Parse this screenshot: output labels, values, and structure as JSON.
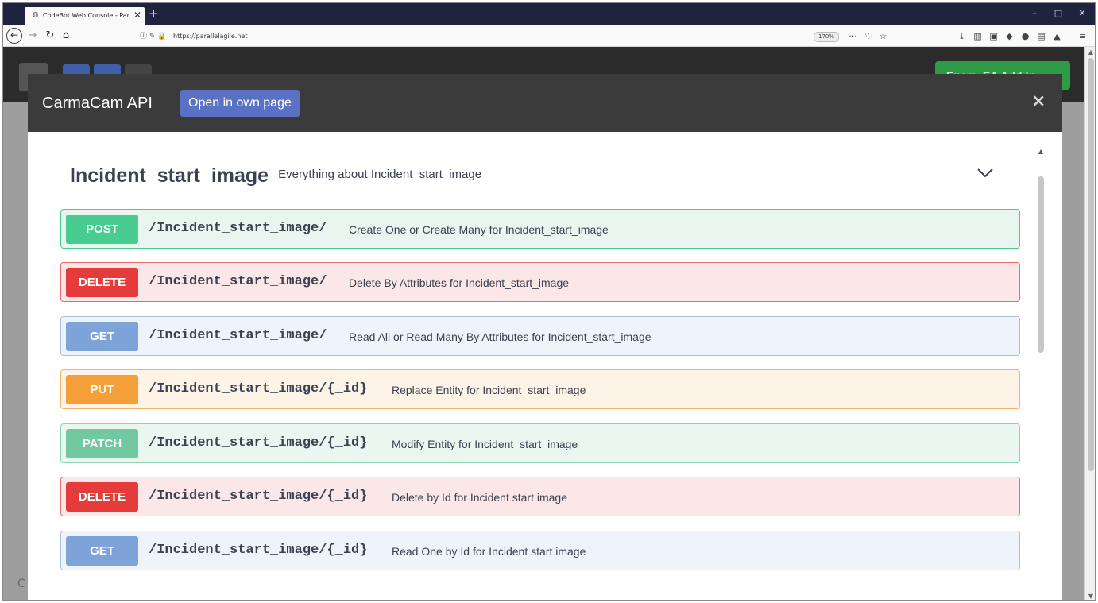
{
  "browser": {
    "tab_title": "CodeBot Web Console - Paral",
    "new_tab": "+",
    "tab_close": "✕",
    "url": "https://parallelagile.net",
    "zoom": "170%",
    "window_controls": {
      "minimize": "–",
      "maximize": "□",
      "close": "✕"
    },
    "nav_icons": [
      "back-icon",
      "forward-icon",
      "reload-icon",
      "home-icon"
    ],
    "url_icons": [
      "info-icon",
      "permissions-icon",
      "lock-icon"
    ],
    "toolbar_icons": [
      "more-icon",
      "pocket-icon",
      "bookmark-star-icon",
      "download-icon",
      "library-icon",
      "reader-icon",
      "shield-icon",
      "addon-icon",
      "extension-icon",
      "extension2-icon",
      "menu-icon"
    ]
  },
  "background_page": {
    "green_button_label": "Enem. EA Add-in",
    "bottom_letter": "C"
  },
  "modal": {
    "title": "CarmaCam API",
    "open_button": "Open in own page",
    "close_label": "×",
    "section": {
      "title": "Incident_start_image",
      "description": "Everything about Incident_start_image",
      "toggle_icon": "chevron-down-icon"
    },
    "operations": [
      {
        "method": "POST",
        "path": "/Incident_start_image/",
        "summary": "Create One or Create Many for Incident_start_image"
      },
      {
        "method": "DELETE",
        "path": "/Incident_start_image/",
        "summary": "Delete By Attributes for Incident_start_image"
      },
      {
        "method": "GET",
        "path": "/Incident_start_image/",
        "summary": "Read All or Read Many By Attributes for Incident_start_image"
      },
      {
        "method": "PUT",
        "path": "/Incident_start_image/{_id}",
        "summary": "Replace Entity for Incident_start_image"
      },
      {
        "method": "PATCH",
        "path": "/Incident_start_image/{_id}",
        "summary": "Modify Entity for Incident_start_image"
      },
      {
        "method": "DELETE",
        "path": "/Incident_start_image/{_id}",
        "summary": "Delete by Id for Incident start image"
      },
      {
        "method": "GET",
        "path": "/Incident_start_image/{_id}",
        "summary": "Read One by Id for Incident start image"
      }
    ]
  },
  "colors": {
    "POST": {
      "badge": "#49cc90",
      "bg": "#e8f6ef",
      "border": "#49cc90"
    },
    "DELETE": {
      "badge": "#e53b3b",
      "bg": "#fbe7e7",
      "border": "#e86a6a"
    },
    "GET": {
      "badge": "#7ea3d8",
      "bg": "#eff4fa",
      "border": "#a9bfe0"
    },
    "PUT": {
      "badge": "#f59f3a",
      "bg": "#fdf3e6",
      "border": "#f3b46a"
    },
    "PATCH": {
      "badge": "#72c9a1",
      "bg": "#eaf6f0",
      "border": "#8ed4b4"
    }
  }
}
